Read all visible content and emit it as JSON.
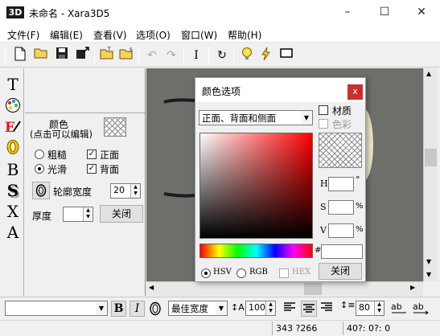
{
  "window": {
    "app_icon": "3D",
    "title": "未命名 - Xara3D5",
    "minimize_icon": "–",
    "maximize_icon": "☐",
    "close_icon": "✕"
  },
  "menu": [
    "文件(F)",
    "编辑(E)",
    "查看(V)",
    "选项(O)",
    "窗口(W)",
    "帮助(H)"
  ],
  "toolbar": {
    "icons": [
      "new-file-icon",
      "open-icon",
      "save-icon",
      "export-icon",
      "open-texture-icon",
      "save-animation-icon",
      "undo-icon",
      "redo-icon",
      "text-cursor-icon",
      "rotate-icon",
      "light-icon",
      "lightning-icon",
      "frame-icon"
    ]
  },
  "tools": {
    "text": "T",
    "bevel": "B",
    "shadow": "S",
    "extrude": "X",
    "texture": "A"
  },
  "panel": {
    "color_label": "颜色",
    "color_hint": "(点击可以编辑)",
    "rough_label": "粗糙",
    "smooth_label": "光滑",
    "front_label": "正面",
    "back_label": "背面",
    "outline_width_label": "轮廓宽度",
    "outline_width_value": "20",
    "thickness_label": "厚度",
    "thickness_value": "",
    "close_button": "关闭",
    "rough_checked": false,
    "smooth_checked": true,
    "front_checked": true,
    "back_checked": true
  },
  "dialog": {
    "title": "颜色选项",
    "close_icon": "x",
    "target_select": "正面、背面和侧面",
    "material_label": "材质",
    "color_label": "色彩",
    "h_label": "H",
    "h_unit": "°",
    "s_label": "S",
    "s_unit": "%",
    "v_label": "V",
    "v_unit": "%",
    "hash_label": "#",
    "hsv_label": "HSV",
    "rgb_label": "RGB",
    "hex_label": "HEX",
    "close_button": "关闭",
    "mode": "HSV"
  },
  "formatbar": {
    "font_value": "",
    "bold": "B",
    "italic": "I",
    "quality_value": "最佳宽度",
    "size_value": "100",
    "line_spacing_value": "80"
  },
  "statusbar": {
    "coords": "343 ?266",
    "angles": "40?: 0?: 0"
  },
  "colors": {
    "accent_close": "#c9302c",
    "canvas": "#6e6e6a"
  }
}
